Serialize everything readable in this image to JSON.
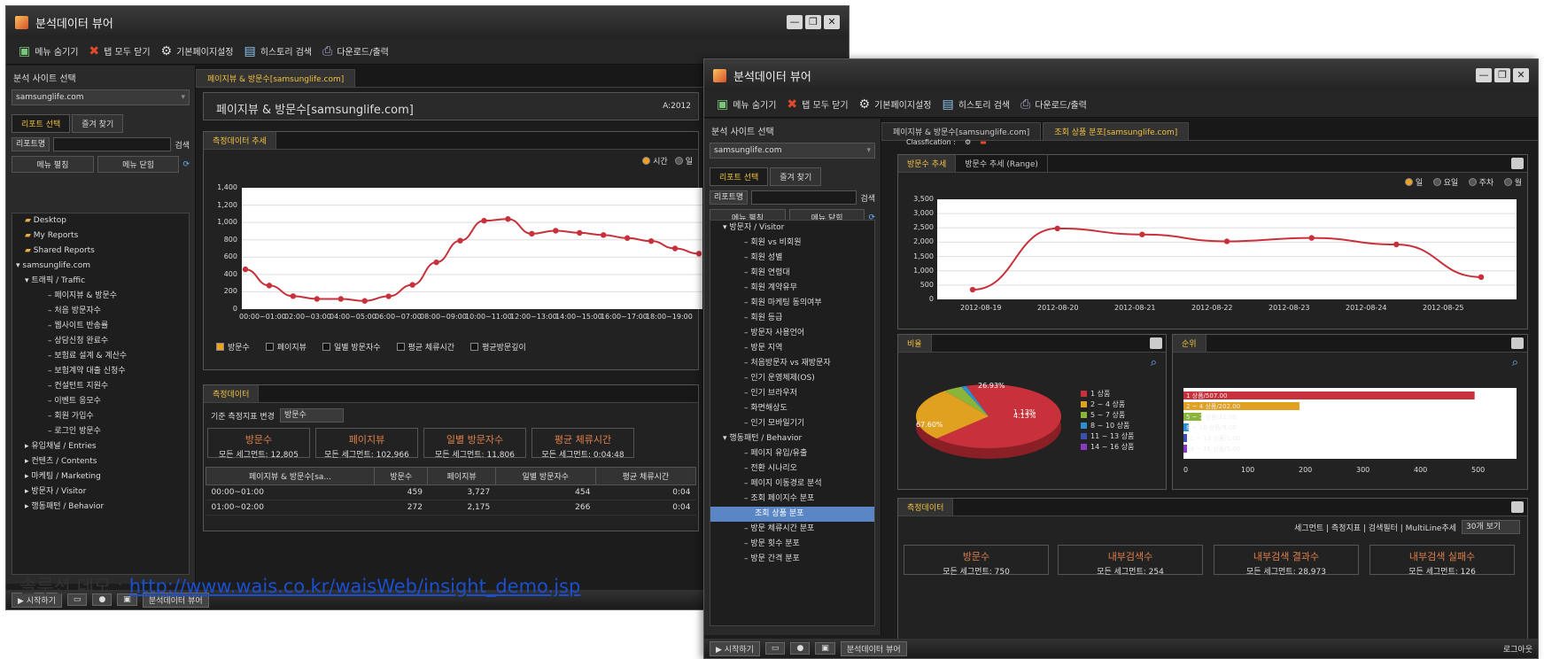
{
  "window1": {
    "title": "분석데이터 뷰어",
    "toolbar": [
      "메뉴 숨기기",
      "탭 모두 닫기",
      "기본페이지설정",
      "히스토리 검색",
      "다운로드/출력"
    ],
    "site_label": "분석 사이트 선택",
    "site_value": "samsunglife.com",
    "side_tabs": [
      "리포트 선택",
      "즐겨 찾기"
    ],
    "search_select": "리포트명",
    "search_btn": "검색",
    "expand_btn": "메뉴 펼침",
    "collapse_btn": "메뉴 닫힘",
    "tree": [
      "Desktop",
      "My Reports",
      "Shared Reports",
      "samsunglife.com",
      "트래픽 / Traffic",
      "페이지뷰 & 방문수",
      "처음 방문자수",
      "웹사이트 반송률",
      "상담신청 완료수",
      "보험료 설계 & 계산수",
      "보험계약 대출 신청수",
      "컨설턴트 지원수",
      "이벤트 응모수",
      "회원 가입수",
      "로그인 방문수",
      "유입채널 / Entries",
      "컨텐츠 / Contents",
      "마케팅 / Marketing",
      "방문자 / Visitor",
      "행동패턴 / Behavior"
    ],
    "tab": "페이지뷰 & 방문수[samsunglife.com]",
    "report_title": "페이지뷰 & 방문수[samsunglife.com]",
    "date_label": "A:2012",
    "trend_tab": "측정데이터 추세",
    "radios": [
      "시간",
      "일"
    ],
    "yticks": [
      "1,400",
      "1,200",
      "1,000",
      "800",
      "600",
      "400",
      "200",
      "0"
    ],
    "xticks": [
      "00:00~01:00",
      "02:00~03:00",
      "04:00~05:00",
      "06:00~07:00",
      "08:00~09:00",
      "10:00~11:00",
      "12:00~13:00",
      "14:00~15:00",
      "16:00~17:00",
      "18:00~19:00"
    ],
    "checks": [
      "방문수",
      "페이지뷰",
      "일별 방문자수",
      "평균 체류시간",
      "평균방문깊이"
    ],
    "data_tab": "측정데이터",
    "metric_label": "기준 측정지표 변경",
    "metric_value": "방문수",
    "cards": [
      {
        "t": "방문수",
        "l": "모든 세그먼트:",
        "v": "12,805"
      },
      {
        "t": "페이지뷰",
        "l": "모든 세그먼트:",
        "v": "102,966"
      },
      {
        "t": "일별 방문자수",
        "l": "모든 세그먼트:",
        "v": "11,806"
      },
      {
        "t": "평균 체류시간",
        "l": "모든 세그먼트:",
        "v": "0:04:48"
      }
    ],
    "table_headers": [
      "페이지뷰 & 방문수[sa...",
      "방문수",
      "페이지뷰",
      "일별 방문자수",
      "평균 체류시간"
    ],
    "rows": [
      [
        "00:00~01:00",
        "459",
        "3,727",
        "454",
        "0:04"
      ],
      [
        "01:00~02:00",
        "272",
        "2,175",
        "266",
        "0:04"
      ]
    ],
    "taskbar": [
      "시작하기",
      "분석데이터 뷰어"
    ]
  },
  "chart1": {
    "type": "line",
    "values": [
      459,
      272,
      150,
      118,
      118,
      95,
      148,
      280,
      540,
      790,
      1020,
      1040,
      870,
      905,
      880,
      855,
      820,
      785,
      700,
      640
    ]
  },
  "window2": {
    "title": "분석데이터 뷰어",
    "toolbar": [
      "메뉴 숨기기",
      "탭 모두 닫기",
      "기본페이지설정",
      "히스토리 검색",
      "다운로드/출력"
    ],
    "site_label": "분석 사이트 선택",
    "site_value": "samsunglife.com",
    "side_tabs": [
      "리포트 선택",
      "즐겨 찾기"
    ],
    "search_select": "리포트명",
    "search_btn": "검색",
    "expand_btn": "메뉴 펼침",
    "collapse_btn": "메뉴 닫힘",
    "tree": [
      "방문자 / Visitor",
      "회원 vs 비회원",
      "회원 성별",
      "회원 연령대",
      "회원 계약유무",
      "회원 마케팅 동의여부",
      "회원 등급",
      "방문자 사용언어",
      "방문 지역",
      "처음방문자 vs 재방문자",
      "인기 운영체제(OS)",
      "인기 브라우저",
      "화면해상도",
      "인기 모바일기기",
      "행동패턴 / Behavior",
      "페이지 유입/유출",
      "전환 시나리오",
      "페이지 이동경로 분석",
      "조회 페이지수 분포",
      "조회 상품 분포",
      "방문 체류시간 분포",
      "방문 횟수 분포",
      "방문 간격 분포"
    ],
    "tabs": [
      "페이지뷰 & 방문수[samsunglife.com]",
      "조회 상품 분포[samsunglife.com]"
    ],
    "classification": "Classfication :",
    "sub_tabs": [
      "방문수 추세",
      "방문수 추세 (Range)"
    ],
    "radios": [
      "일",
      "요일",
      "주차",
      "월"
    ],
    "yticks": [
      "3,500",
      "3,000",
      "2,500",
      "2,000",
      "1,500",
      "1,000",
      "500",
      "0"
    ],
    "xticks": [
      "2012-08-19",
      "2012-08-20",
      "2012-08-21",
      "2012-08-22",
      "2012-08-23",
      "2012-08-24",
      "2012-08-25"
    ],
    "ratio_tab": "비율",
    "rank_tab": "순위",
    "pie_labels": [
      "26.93%",
      "67.60%",
      "1.13%",
      "4.13%"
    ],
    "legend": [
      "1 상품",
      "2 ~ 4 상품",
      "5 ~ 7 상품",
      "8 ~ 10 상품",
      "11 ~ 13 상품",
      "14 ~ 16 상품"
    ],
    "bars": [
      "1 상품/507.00",
      "2 ~ 4 상품/202.00",
      "5 ~ 7 상품/31.00",
      "8 ~ 10 상품/9.00",
      "11 ~ 13 상품/1.00",
      "14 ~ 16 상품/1.00"
    ],
    "bar_ticks": [
      "0",
      "100",
      "200",
      "300",
      "400",
      "500"
    ],
    "data_tab": "측정데이터",
    "filters": "세그먼트 | 측정지표 | 검색필터 | MultiLine추세",
    "per_page": "30개 보기",
    "cards": [
      {
        "t": "방문수",
        "v": "모든 세그먼트:   750"
      },
      {
        "t": "내부검색수",
        "v": "모든 세그먼트:   254"
      },
      {
        "t": "내부검색 결과수",
        "v": "모든 세그먼트:   28,973"
      },
      {
        "t": "내부검색 실패수",
        "v": "모든 세그먼트:   126"
      }
    ],
    "taskbar": [
      "시작하기",
      "분석데이터 뷰어",
      "로그아웃"
    ]
  },
  "chart2": {
    "type": "line",
    "values": [
      340,
      2480,
      2270,
      2030,
      2150,
      1920,
      780
    ]
  },
  "bars_data": {
    "type": "bar",
    "values": [
      507,
      202,
      31,
      9,
      1,
      1
    ]
  },
  "pie_data": {
    "type": "pie",
    "values": [
      67.6,
      26.93,
      4.13,
      1.13
    ],
    "colors": [
      "#c8313b",
      "#e0a020",
      "#8ab43a",
      "#2b8fd0"
    ]
  },
  "caption": {
    "text": "솔루션 데모 : ",
    "link": "http://www.wais.co.kr/waisWeb/insight_demo.jsp"
  }
}
